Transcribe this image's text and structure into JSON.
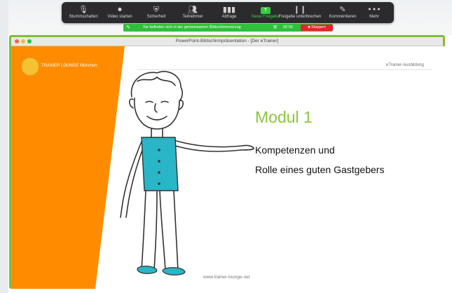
{
  "toolbar": {
    "items": [
      {
        "label": "Stummschalten",
        "icon": "microphone-icon"
      },
      {
        "label": "Video starten",
        "icon": "video-camera-icon"
      },
      {
        "label": "Sicherheit",
        "icon": "shield-icon"
      },
      {
        "label": "Teilnehmer",
        "icon": "participants-icon"
      },
      {
        "label": "Abfrage",
        "icon": "poll-icon"
      },
      {
        "label": "Neue Freigabe",
        "icon": "share-screen-icon"
      },
      {
        "label": "Freigabe unterbrechen",
        "icon": "pause-icon"
      },
      {
        "label": "Kommentieren",
        "icon": "pencil-icon"
      },
      {
        "label": "Mehr",
        "icon": "more-icon"
      }
    ]
  },
  "sharebar": {
    "message": "Sie befinden sich in der gemeinsamen Bildschirmnutzung",
    "timer": "02:00",
    "stop_label": "Stoppen"
  },
  "window": {
    "title": "PowerPoint-Bildschirmpräsentation - [Der eTrainer]"
  },
  "slide": {
    "logo_text": "TRAINER LOUNGE München",
    "tagline": "eTrainer-Ausbildung",
    "heading": "Modul 1",
    "subtitle_line1": "Kompetenzen und",
    "subtitle_line2": "Rolle eines guten Gastgebers",
    "url": "www.trainer-lounge.net"
  },
  "colors": {
    "accent_orange": "#ff8c00",
    "heading_green": "#8cc63f",
    "share_green": "#2fbf3a",
    "stop_red": "#e5242b",
    "shirt_teal": "#29b6c6",
    "frame_green": "#7fbf3a"
  }
}
